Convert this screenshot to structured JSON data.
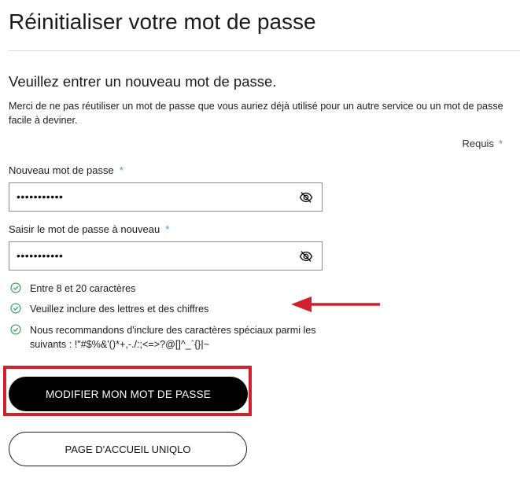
{
  "page": {
    "title": "Réinitialiser votre mot de passe",
    "subtitle": "Veuillez entrer un nouveau mot de passe.",
    "description": "Merci de ne pas réutiliser un mot de passe que vous auriez déjà utilisé pour un autre service ou un mot de passe facile à deviner.",
    "required_label": "Requis",
    "required_mark": "*"
  },
  "form": {
    "new_password": {
      "label": "Nouveau mot de passe",
      "required_mark": "*",
      "value": "•••••••••••",
      "toggle_icon": "eye-slash-icon"
    },
    "confirm_password": {
      "label": "Saisir le mot de passe à nouveau",
      "required_mark": "*",
      "value": "•••••••••••",
      "toggle_icon": "eye-slash-icon"
    }
  },
  "rules": [
    {
      "text": "Entre 8 et 20 caractères",
      "icon": "check-circle-icon"
    },
    {
      "text": "Veuillez inclure des lettres et des chiffres",
      "icon": "check-circle-icon"
    },
    {
      "text": "Nous recommandons d'inclure des caractères spéciaux parmi les suivants : !\"#$%&'()*+,-./:;<=>?@[]^_`{}|~",
      "icon": "check-circle-icon"
    }
  ],
  "buttons": {
    "submit": "MODIFIER MON MOT DE PASSE",
    "home": "PAGE D'ACCUEIL UNIQLO"
  },
  "colors": {
    "check": "#2f9e5a",
    "star": "#4a8fd3",
    "annotation": "#d0202b",
    "primary_button": "#000000"
  }
}
